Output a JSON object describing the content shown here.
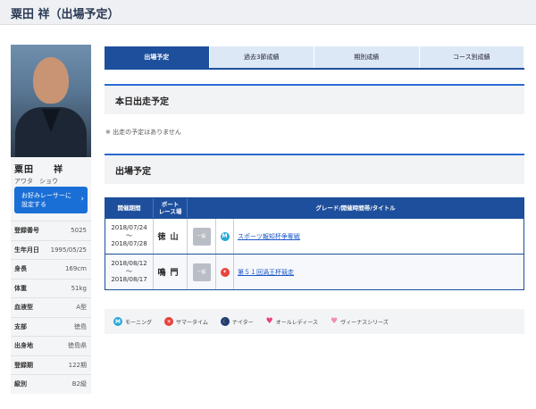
{
  "header": {
    "title": "粟田 祥（出場予定）"
  },
  "profile": {
    "name_kanji": "粟田　　祥",
    "name_kana": "アワタ　ショウ",
    "favorite_button": {
      "line1": "お好みレーサーに",
      "line2": "設定する",
      "chevron": "›"
    },
    "info": [
      {
        "label": "登録番号",
        "value": "5025"
      },
      {
        "label": "生年月日",
        "value": "1995/05/25"
      },
      {
        "label": "身長",
        "value": "169cm"
      },
      {
        "label": "体重",
        "value": "51kg"
      },
      {
        "label": "血液型",
        "value": "A型"
      },
      {
        "label": "支部",
        "value": "徳島"
      },
      {
        "label": "出身地",
        "value": "徳島県"
      },
      {
        "label": "登録期",
        "value": "122期"
      },
      {
        "label": "級別",
        "value": "B2級"
      }
    ]
  },
  "tabs": [
    {
      "label": "出場予定",
      "active": true
    },
    {
      "label": "過去3節成績",
      "active": false
    },
    {
      "label": "期別成績",
      "active": false
    },
    {
      "label": "コース別成績",
      "active": false
    }
  ],
  "today": {
    "heading": "本日出走予定",
    "message": "※ 出走の予定はありません"
  },
  "schedule": {
    "heading": "出場予定",
    "columns": {
      "date": "開催期間",
      "venue_line1": "ボート",
      "venue_line2": "レース場",
      "title": "グレード/開催時間帯/タイトル"
    },
    "rows": [
      {
        "start": "2018/07/24",
        "tilde": "～",
        "end": "2018/07/28",
        "venue": "徳山",
        "grade": "一般",
        "time_icon": "morning",
        "title": "スポーツ報知杯争奪戦"
      },
      {
        "start": "2018/08/12",
        "tilde": "～",
        "end": "2018/08/17",
        "venue": "鳴門",
        "grade": "一般",
        "time_icon": "summer",
        "title": "第５１回渦王杯競走"
      }
    ]
  },
  "legend": [
    {
      "icon": "morning",
      "label": "モーニング"
    },
    {
      "icon": "summer",
      "label": "サマータイム"
    },
    {
      "icon": "night",
      "label": "ナイター"
    },
    {
      "icon": "ladies",
      "label": "オールレディース"
    },
    {
      "icon": "venus",
      "label": "ヴィーナスシリーズ"
    }
  ],
  "icon_glyphs": {
    "morning": "M",
    "summer": "☀",
    "night": "☾",
    "heart": "♥"
  },
  "colors": {
    "accent": "#1d4f9c",
    "button": "#1a6fd6",
    "link": "#1a56c8"
  }
}
